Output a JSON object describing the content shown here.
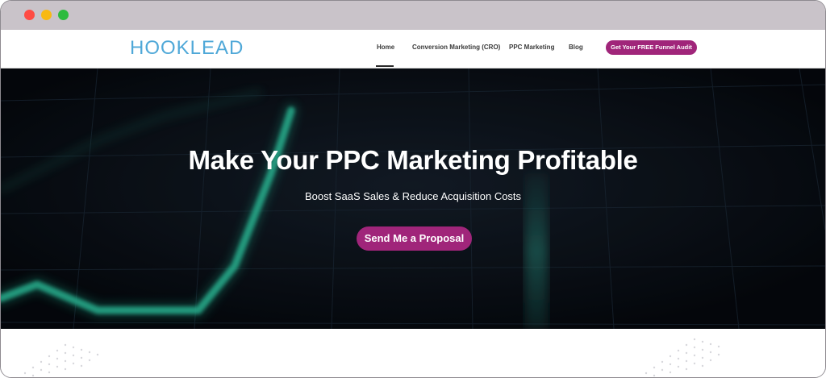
{
  "window": {
    "controls": [
      "close",
      "minimize",
      "maximize"
    ]
  },
  "header": {
    "logo_text": "HOOKLEAD",
    "nav": [
      {
        "label": "Home",
        "active": true
      },
      {
        "label": "Conversion Marketing (CRO)"
      },
      {
        "label": "PPC Marketing"
      },
      {
        "label": "Blog"
      }
    ],
    "cta_label": "Get Your FREE Funnel Audit"
  },
  "hero": {
    "title": "Make Your PPC Marketing Profitable",
    "subtitle": "Boost SaaS Sales & Reduce Acquisition Costs",
    "cta_label": "Send Me a Proposal"
  },
  "colors": {
    "accent": "#a0257a",
    "logo": "#4fa8d8",
    "hero_background": "#090d14",
    "hero_line": "#2fc7a2",
    "titlebar": "#c9c3c9"
  }
}
